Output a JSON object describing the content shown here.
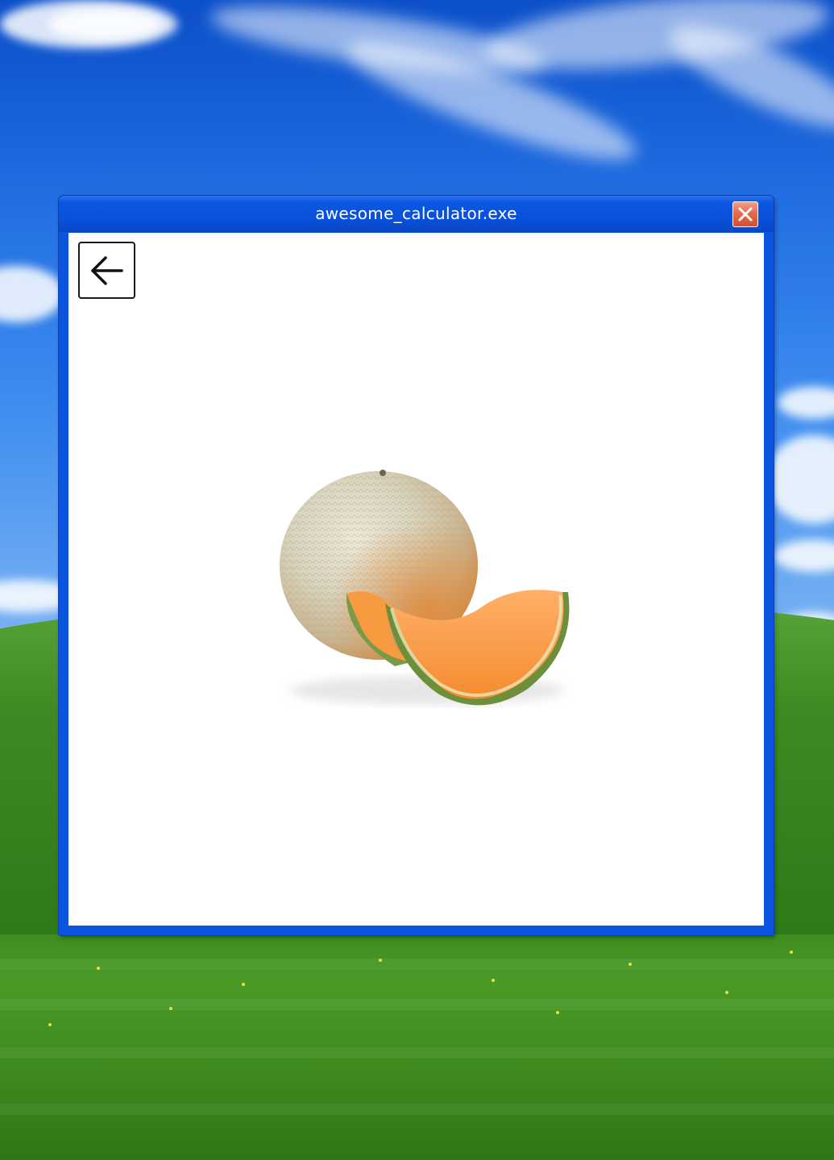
{
  "window": {
    "title": "awesome_calculator.exe",
    "close_icon": "close-icon",
    "accent_color": "#0b54e0",
    "close_color": "#e46a4c"
  },
  "content": {
    "back_icon": "arrow-left-icon",
    "image_subject": "cantaloupe-melon"
  }
}
